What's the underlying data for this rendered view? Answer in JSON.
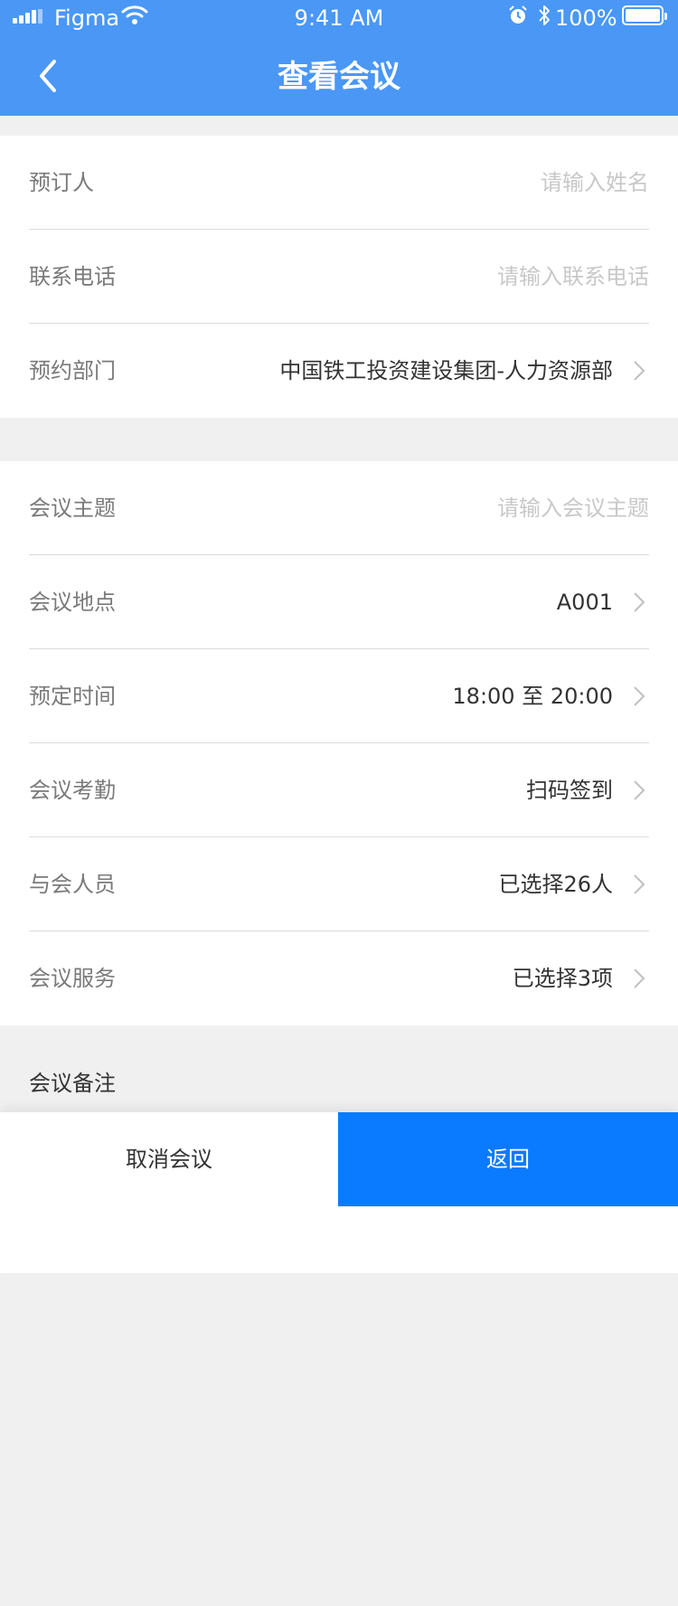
{
  "status_bar": {
    "carrier": "Figma",
    "time": "9:41 AM",
    "battery": "100%"
  },
  "nav": {
    "title": "查看会议",
    "back_icon": "chevron-left-icon"
  },
  "booker_section": {
    "rows": [
      {
        "label": "预订人",
        "placeholder": "请输入姓名",
        "value": ""
      },
      {
        "label": "联系电话",
        "placeholder": "请输入联系电话",
        "value": ""
      },
      {
        "label": "预约部门",
        "value": "中国铁工投资建设集团-人力资源部"
      }
    ]
  },
  "meeting_section": {
    "rows": [
      {
        "label": "会议主题",
        "placeholder": "请输入会议主题",
        "value": ""
      },
      {
        "label": "会议地点",
        "value": "A001"
      },
      {
        "label": "预定时间",
        "value": "18:00 至 20:00"
      },
      {
        "label": "会议考勤",
        "value": "扫码签到"
      },
      {
        "label": "与会人员",
        "value": "已选择26人"
      },
      {
        "label": "会议服务",
        "value": "已选择3项"
      }
    ]
  },
  "remarks": {
    "label": "会议备注"
  },
  "actions": {
    "cancel_label": "取消会议",
    "return_label": "返回"
  },
  "colors": {
    "header_bg": "#4a97f6",
    "primary_button": "#0a7bff",
    "page_bg": "#f0f0f0",
    "placeholder": "#c8c8c8",
    "label": "#7a7a7a"
  }
}
